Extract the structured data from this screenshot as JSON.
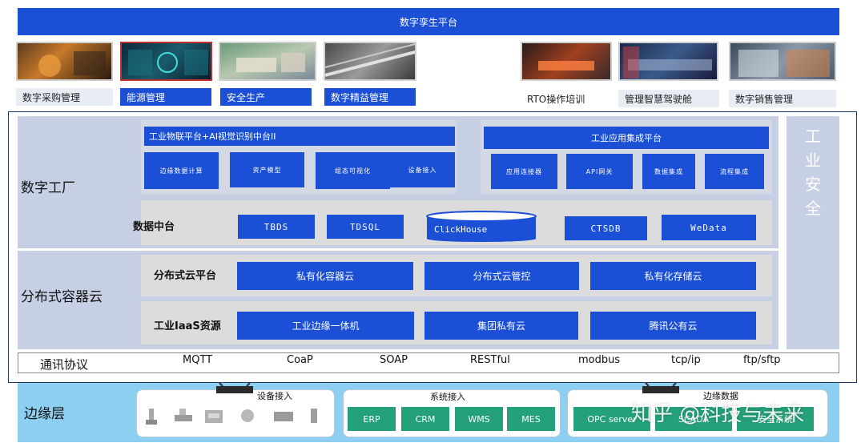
{
  "header": {
    "title": "数字孪生平台"
  },
  "apps": [
    {
      "label": "数字采购管理"
    },
    {
      "label": "能源管理"
    },
    {
      "label": "安全生产"
    },
    {
      "label": "数字精益管理"
    },
    {
      "label": "RTO操作培训"
    },
    {
      "label": "管理智慧驾驶舱"
    },
    {
      "label": "数字销售管理"
    }
  ],
  "digital_factory": {
    "title": "数字工厂",
    "iot_platform": {
      "title": "工业物联平台+AI视觉识别中台II",
      "items": [
        "边缘数据计算",
        "资产模型",
        "组态可视化",
        "设备接入"
      ]
    },
    "app_integration": {
      "title": "工业应用集成平台",
      "items": [
        "应用连接器",
        "API网关",
        "数据集成",
        "流程集成"
      ]
    },
    "data_platform": {
      "title": "数据中台",
      "items": [
        "TBDS",
        "TDSQL",
        "ClickHouse",
        "CTSDB",
        "WeData"
      ]
    }
  },
  "container_cloud": {
    "title": "分布式容器云",
    "platform": {
      "title": "分布式云平台",
      "items": [
        "私有化容器云",
        "分布式云管控",
        "私有化存储云"
      ]
    },
    "iaas": {
      "title": "工业IaaS资源",
      "items": [
        "工业边缘一体机",
        "集团私有云",
        "腾讯公有云"
      ]
    }
  },
  "security": {
    "chars": [
      "工",
      "业",
      "安",
      "全"
    ]
  },
  "protocols": {
    "title": "通讯协议",
    "items": [
      "MQTT",
      "CoaP",
      "SOAP",
      "RESTful",
      "modbus",
      "tcp/ip",
      "ftp/sftp"
    ]
  },
  "edge": {
    "title": "边缘层",
    "device_access": {
      "title": "设备接入"
    },
    "system_access": {
      "title": "系统接入",
      "items": [
        "ERP",
        "CRM",
        "WMS",
        "MES"
      ]
    },
    "edge_data": {
      "title": "边缘数据",
      "items": [
        "OPC server",
        "SCADA",
        "安全系统"
      ]
    }
  },
  "watermark": "知乎 @科技与未来"
}
